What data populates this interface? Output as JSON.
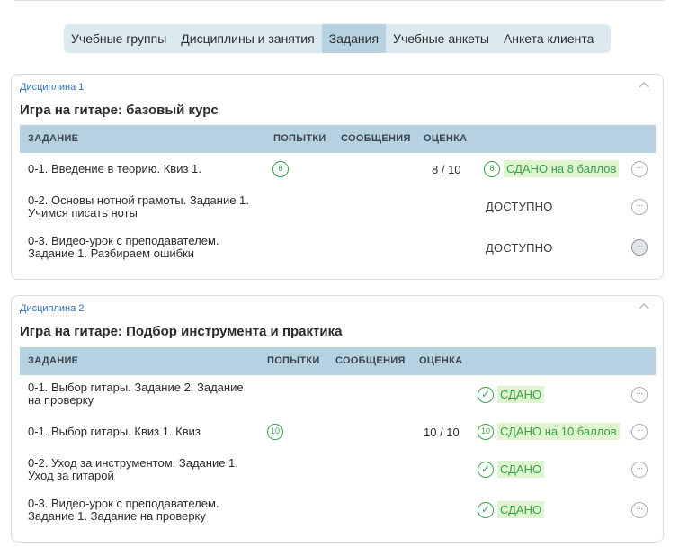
{
  "tabs": [
    {
      "label": "Учебные группы",
      "active": false
    },
    {
      "label": "Дисциплины и занятия",
      "active": false
    },
    {
      "label": "Задания",
      "active": true
    },
    {
      "label": "Учебные анкеты",
      "active": false
    },
    {
      "label": "Анкета клиента",
      "active": false
    }
  ],
  "columns": {
    "task": "ЗАДАНИЕ",
    "attempts": "ПОПЫТКИ",
    "messages": "СООБЩЕНИЯ",
    "grade": "ОЦЕНКА"
  },
  "more_glyph": "···",
  "check_glyph": "✓",
  "colors": {
    "tab_bar": "#dbe9f1",
    "tab_active": "#b6d1e0",
    "table_header": "#b6d1e0",
    "success": "#3aa04a",
    "success_bg": "#dff5cf",
    "caption": "#2f6fb0"
  },
  "disciplines": [
    {
      "caption": "Дисциплина 1",
      "title": "Игра на гитаре: базовый курс",
      "rows": [
        {
          "task_line1": "0-1. Введение в теорию. Квиз 1.",
          "task_line2": "",
          "attempts": "8",
          "score": "8 / 10",
          "status_count": "8",
          "status": "СДАНО на 8 баллов"
        },
        {
          "task_line1": "0-2. Основы нотной грамоты. Задание 1.",
          "task_line2": "Учимся писать ноты",
          "status": "ДОСТУПНО"
        },
        {
          "task_line1": "0-3. Видео-урок с преподавателем.",
          "task_line2": "Задание 1. Разбираем ошибки",
          "status": "ДОСТУПНО"
        }
      ]
    },
    {
      "caption": "Дисциплина 2",
      "title": "Игра на гитаре: Подбор инструмента и практика",
      "rows": [
        {
          "task_line1": "0-1. Выбор гитары. Задание 2. Задание",
          "task_line2": "на проверку",
          "status": "СДАНО"
        },
        {
          "task_line1": "0-1. Выбор гитары. Квиз 1. Квиз",
          "task_line2": "",
          "attempts": "10",
          "score": "10 / 10",
          "status_count": "10",
          "status": "СДАНО на 10 баллов"
        },
        {
          "task_line1": "0-2. Уход за инструментом. Задание 1.",
          "task_line2": "Уход за гитарой",
          "status": "СДАНО"
        },
        {
          "task_line1": "0-3. Видео-урок с преподавателем.",
          "task_line2": "Задание 1. Задание на проверку",
          "status": "СДАНО"
        }
      ]
    }
  ]
}
